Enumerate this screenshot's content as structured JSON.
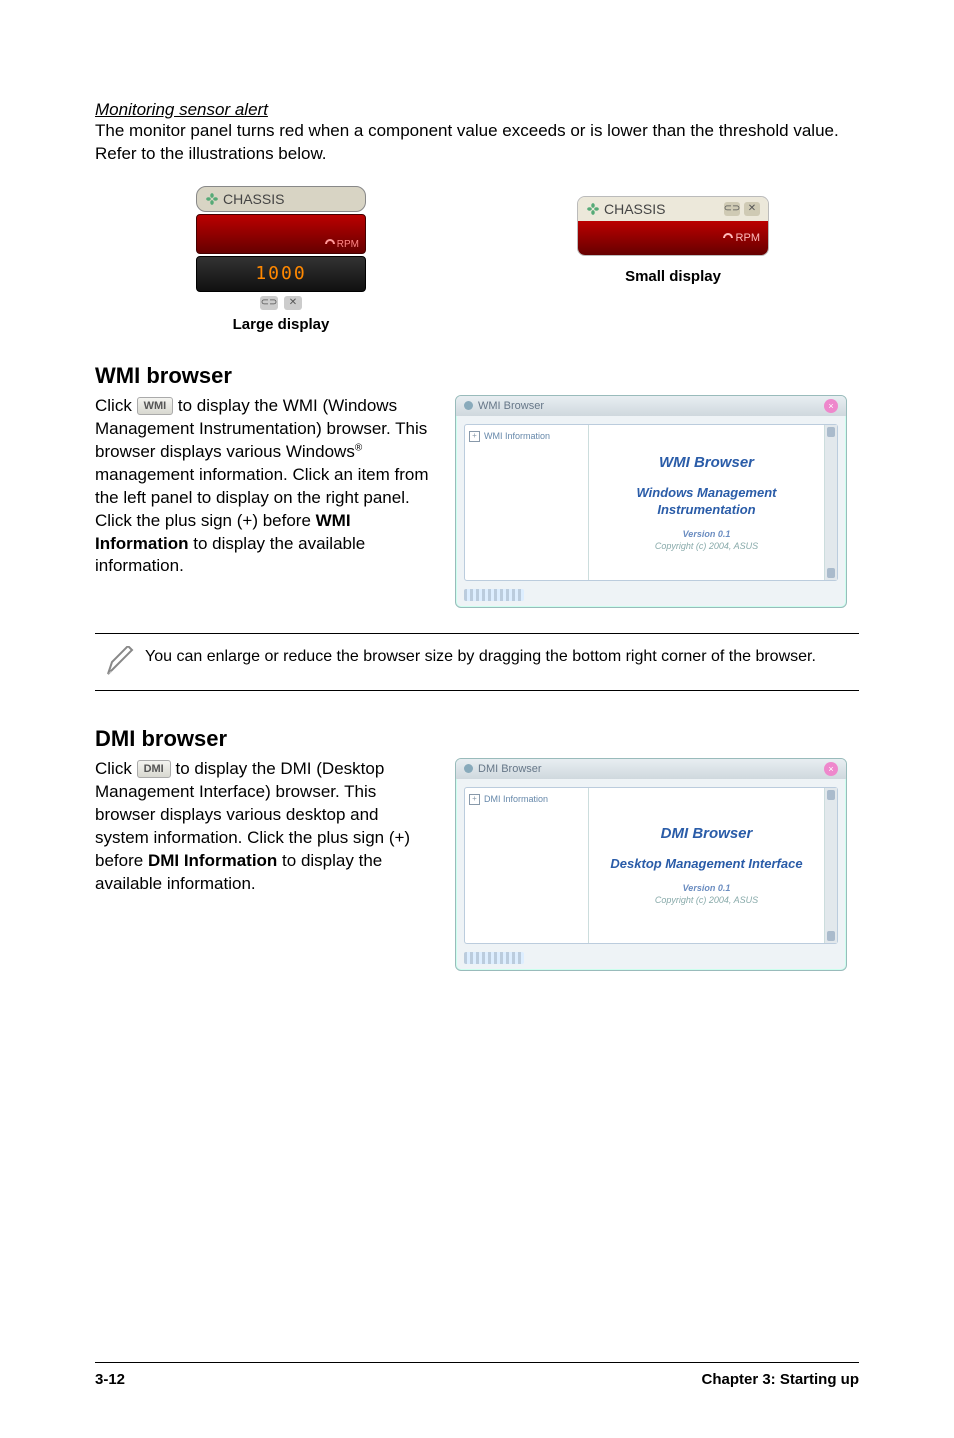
{
  "sensor_alert": {
    "heading": "Monitoring sensor alert",
    "body": "The monitor panel turns red when a component value exceeds or is lower than the threshold value. Refer to the illustrations below.",
    "large_caption": "Large display",
    "small_caption": "Small display",
    "chassis_label": "CHASSIS",
    "rpm_label": "RPM",
    "segment_value": "1000"
  },
  "wmi": {
    "title": "WMI browser",
    "chip_label": "WMI",
    "para_prefix": "Click ",
    "para_body": " to display the WMI (Windows Management Instrumentation) browser. This browser displays various Windows® management information. Click an item from the left panel to display on the right panel. Click the plus sign (+) before WMI Information to display the available information.",
    "bold_term": "WMI Information",
    "para_body_1": " to display the WMI (Windows Management Instrumentation) browser. This browser displays various Windows",
    "para_body_2": " management information. Click an item from the left panel to display on the right panel. Click the plus sign (+) before ",
    "para_body_3": " to display the available information.",
    "window": {
      "titlebar": "WMI Browser",
      "tree_root": "WMI Information",
      "main_title": "WMI  Browser",
      "subtitle": "Windows Management Instrumentation",
      "version": "Version 0.1",
      "copyright": "Copyright (c) 2004,  ASUS"
    }
  },
  "note": {
    "text": "You can enlarge or reduce the browser size by dragging the bottom right corner of the browser."
  },
  "dmi": {
    "title": "DMI browser",
    "chip_label": "DMI",
    "para_prefix": "Click ",
    "para_body_1": " to display the DMI (Desktop Management Interface) browser. This browser displays various desktop and system information. Click the plus sign (+) before ",
    "bold_term": "DMI Information",
    "para_body_2": " to display the available information.",
    "window": {
      "titlebar": "DMI Browser",
      "tree_root": "DMI Information",
      "main_title": "DMI  Browser",
      "subtitle": "Desktop Management Interface",
      "version": "Version 0.1",
      "copyright": "Copyright (c) 2004,  ASUS"
    }
  },
  "footer": {
    "left": "3-12",
    "right": "Chapter 3: Starting up"
  }
}
